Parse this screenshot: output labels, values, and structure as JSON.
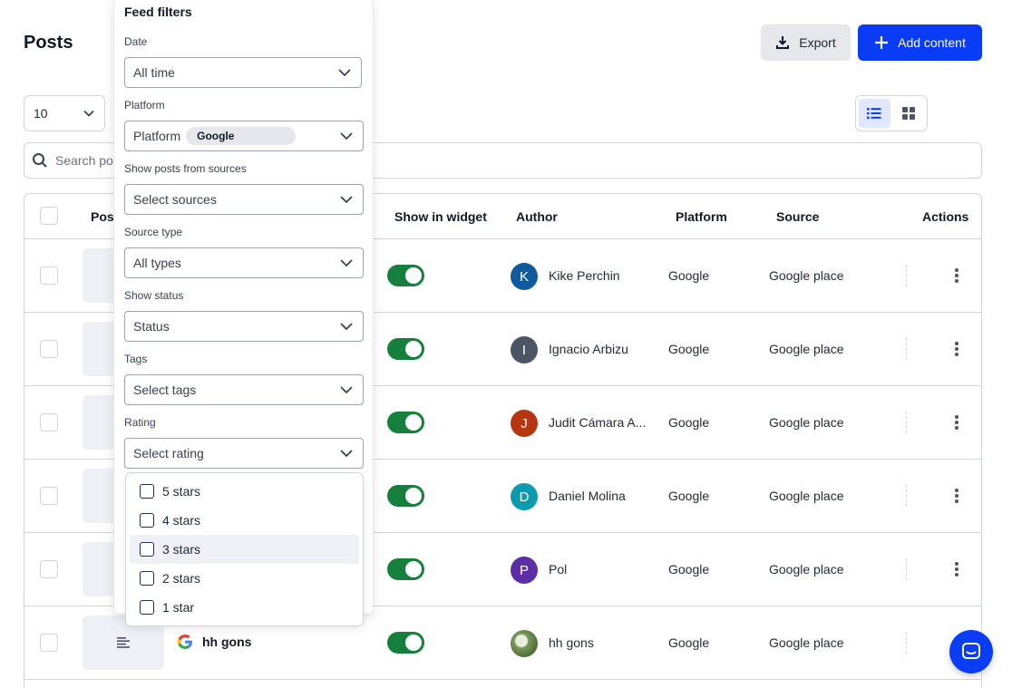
{
  "header": {
    "title": "Posts",
    "export_label": "Export",
    "add_label": "Add content"
  },
  "per_page": {
    "value": "10"
  },
  "search": {
    "placeholder": "Search posts"
  },
  "table": {
    "columns": [
      "Post",
      "Show in widget",
      "Author",
      "Platform",
      "Source",
      "Actions"
    ],
    "rows": [
      {
        "post": "",
        "author": "Kike Perchin",
        "initial": "K",
        "avatar_color": "#0f5a9c",
        "platform": "Google",
        "source": "Google place",
        "show_in_widget": true
      },
      {
        "post": "",
        "author": "Ignacio Arbizu",
        "initial": "I",
        "avatar_color": "#4b5563",
        "platform": "Google",
        "source": "Google place",
        "show_in_widget": true
      },
      {
        "post": "",
        "author": "Judit Cámara A...",
        "initial": "J",
        "avatar_color": "#b8360f",
        "platform": "Google",
        "source": "Google place",
        "show_in_widget": true
      },
      {
        "post": "",
        "author": "Daniel Molina",
        "initial": "D",
        "avatar_color": "#0d9bb0",
        "platform": "Google",
        "source": "Google place",
        "show_in_widget": true
      },
      {
        "post": "",
        "author": "Pol",
        "initial": "P",
        "avatar_color": "#5b2ea6",
        "platform": "Google",
        "source": "Google place",
        "show_in_widget": true
      },
      {
        "post": "hh gons",
        "author": "hh gons",
        "initial": "",
        "avatar_color": "#6b8e4e",
        "platform": "Google",
        "source": "Google place",
        "show_in_widget": true
      }
    ]
  },
  "filters": {
    "title": "Feed filters",
    "date": {
      "label": "Date",
      "value": "All time"
    },
    "platform": {
      "label": "Platform",
      "value": "Platform",
      "chip": "Google"
    },
    "sources": {
      "label": "Show posts from sources",
      "value": "Select sources"
    },
    "source_type": {
      "label": "Source type",
      "value": "All types"
    },
    "status": {
      "label": "Show status",
      "value": "Status"
    },
    "tags": {
      "label": "Tags",
      "value": "Select tags"
    },
    "rating": {
      "label": "Rating",
      "value": "Select rating",
      "options": [
        "5 stars",
        "4 stars",
        "3 stars",
        "2 stars",
        "1 star"
      ]
    }
  },
  "colors": {
    "accent": "#0a3cf5",
    "toggle_on": "#15803d"
  }
}
